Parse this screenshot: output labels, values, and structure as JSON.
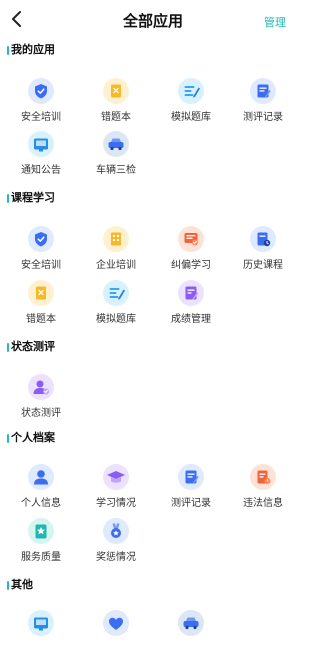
{
  "header": {
    "title": "全部应用",
    "manage": "管理"
  },
  "sections": [
    {
      "title": "我的应用",
      "items": [
        {
          "label": "安全培训",
          "icon": "shield-check-icon"
        },
        {
          "label": "错题本",
          "icon": "notebook-icon"
        },
        {
          "label": "模拟题库",
          "icon": "pencil-lines-icon"
        },
        {
          "label": "测评记录",
          "icon": "record-list-icon"
        },
        {
          "label": "通知公告",
          "icon": "notice-board-icon"
        },
        {
          "label": "车辆三检",
          "icon": "car-icon"
        }
      ]
    },
    {
      "title": "课程学习",
      "items": [
        {
          "label": "安全培训",
          "icon": "shield-check-icon"
        },
        {
          "label": "企业培训",
          "icon": "building-icon"
        },
        {
          "label": "纠偏学习",
          "icon": "correction-board-icon"
        },
        {
          "label": "历史课程",
          "icon": "history-course-icon"
        },
        {
          "label": "错题本",
          "icon": "notebook-icon"
        },
        {
          "label": "模拟题库",
          "icon": "pencil-lines-icon"
        },
        {
          "label": "成绩管理",
          "icon": "grade-manage-icon"
        }
      ]
    },
    {
      "title": "状态测评",
      "items": [
        {
          "label": "状态测评",
          "icon": "user-check-icon"
        }
      ]
    },
    {
      "title": "个人档案",
      "items": [
        {
          "label": "个人信息",
          "icon": "user-icon"
        },
        {
          "label": "学习情况",
          "icon": "graduation-cap-icon"
        },
        {
          "label": "测评记录",
          "icon": "record-list-icon"
        },
        {
          "label": "违法信息",
          "icon": "violation-doc-icon"
        },
        {
          "label": "服务质量",
          "icon": "star-badge-icon"
        },
        {
          "label": "奖惩情况",
          "icon": "medal-icon"
        }
      ]
    },
    {
      "title": "其他",
      "items": [
        {
          "label": "",
          "icon": "notice-board-icon"
        },
        {
          "label": "",
          "icon": "heart-icon"
        },
        {
          "label": "",
          "icon": "car-icon"
        }
      ]
    }
  ]
}
